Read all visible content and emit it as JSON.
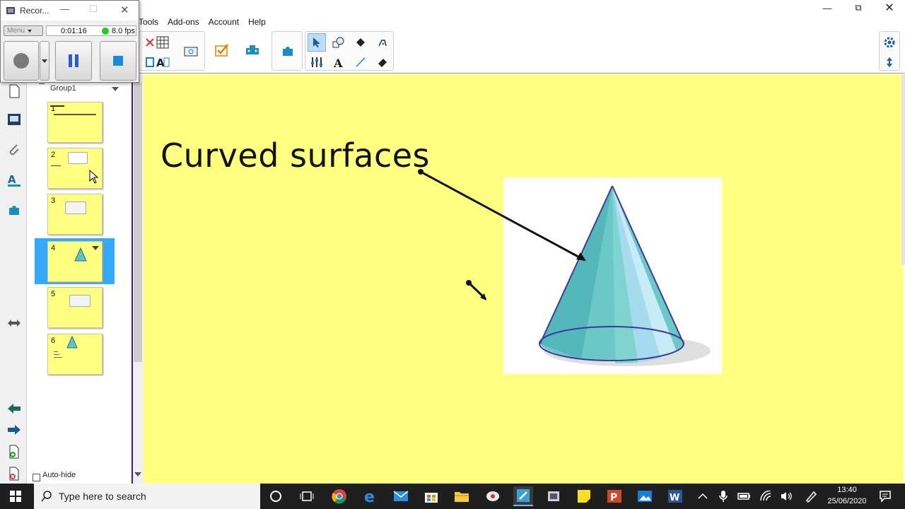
{
  "recorder": {
    "title": "Recor...",
    "menu_label": "Menu",
    "timer": "0:01:16",
    "fps": "8.0 fps"
  },
  "menubar": {
    "items": [
      "Tools",
      "Add-ons",
      "Account",
      "Help"
    ]
  },
  "sorter": {
    "group_label": "Group1",
    "thumbnails": [
      "1",
      "2",
      "3",
      "4",
      "5",
      "6"
    ],
    "autohide_label": "Auto-hide"
  },
  "slide": {
    "title": "Curved surfaces",
    "background_color": "#ffff80"
  },
  "taskbar": {
    "search_placeholder": "Type here to search",
    "time": "13:40",
    "date": "25/06/2020"
  },
  "colors": {
    "selection": "#33aaff",
    "taskbar": "#1f1f1f",
    "toolbar_accent": "#1a7fd0"
  }
}
